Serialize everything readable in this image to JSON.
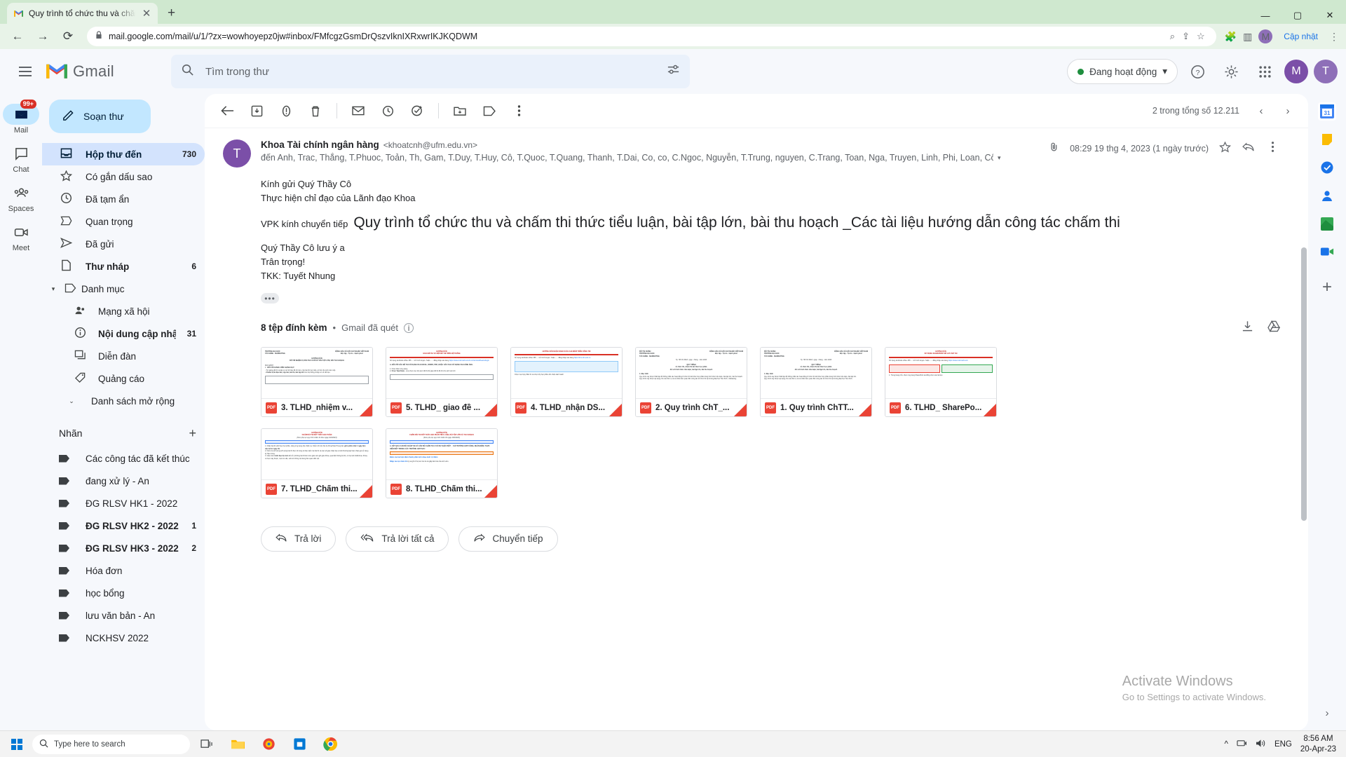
{
  "browser": {
    "tab": {
      "title": "Quy trình tổ chức thu và chăm th",
      "favicon": "gmail-icon",
      "close": "✕"
    },
    "newtab": "+",
    "window_controls": {
      "minimize": "—",
      "maximize": "▢",
      "close": "✕"
    },
    "nav": {
      "back": "←",
      "forward": "→",
      "reload": "⟳"
    },
    "url": "mail.google.com/mail/u/1/?zx=wowhoyepz0jw#inbox/FMfcgzGsmDrQszvIknIXRxwrIKJKQDWM",
    "lock_icon": "lock-icon",
    "omni_icons": [
      "zoom-icon",
      "share-icon",
      "bookmark-star-icon"
    ],
    "ext_icons": [
      "puzzle-extension-icon",
      "sidepanel-icon"
    ],
    "profile_initial": "M",
    "update_label": "Cập nhật",
    "menu": "⋮"
  },
  "gmail": {
    "logo_text": "Gmail",
    "search": {
      "placeholder": "Tìm trong thư",
      "value": "",
      "icon": "search-icon",
      "options_icon": "search-options-icon"
    },
    "status_chip": {
      "label": "Đang hoạt động",
      "dot_color": "#1e8e3e",
      "caret": "▾"
    },
    "header_icons": [
      "help-icon",
      "settings-gear-icon",
      "apps-grid-icon"
    ],
    "workspace_initial": "M",
    "account_initial": "T"
  },
  "rail": [
    {
      "label": "Mail",
      "icon": "mail-icon",
      "badge": "99+",
      "active": true
    },
    {
      "label": "Chat",
      "icon": "chat-icon",
      "badge": "",
      "active": false
    },
    {
      "label": "Spaces",
      "icon": "spaces-icon",
      "badge": "",
      "active": false
    },
    {
      "label": "Meet",
      "icon": "meet-camera-icon",
      "badge": "",
      "active": false
    }
  ],
  "sidebar": {
    "compose": {
      "label": "Soạn thư",
      "icon": "pencil-icon"
    },
    "nav": [
      {
        "label": "Hộp thư đến",
        "icon": "inbox-icon",
        "count": "730",
        "active": true,
        "bold": true
      },
      {
        "label": "Có gắn dấu sao",
        "icon": "star-icon",
        "count": "",
        "active": false,
        "bold": false
      },
      {
        "label": "Đã tạm ẩn",
        "icon": "clock-icon",
        "count": "",
        "active": false,
        "bold": false
      },
      {
        "label": "Quan trọng",
        "icon": "important-marker-icon",
        "count": "",
        "active": false,
        "bold": false
      },
      {
        "label": "Đã gửi",
        "icon": "send-icon",
        "count": "",
        "active": false,
        "bold": false
      },
      {
        "label": "Thư nháp",
        "icon": "draft-file-icon",
        "count": "6",
        "active": false,
        "bold": true
      }
    ],
    "categories": {
      "label": "Danh mục",
      "icon": "label-tag-icon",
      "caret": "▾"
    },
    "sub_items": [
      {
        "label": "Mạng xã hội",
        "icon": "social-people-icon",
        "count": "",
        "bold": false
      },
      {
        "label": "Nội dung cập nhật",
        "icon": "info-circle-icon",
        "count": "31",
        "bold": true
      },
      {
        "label": "Diễn đàn",
        "icon": "forums-icon",
        "count": "",
        "bold": false
      },
      {
        "label": "Quảng cáo",
        "icon": "promotions-tag-icon",
        "count": "",
        "bold": false
      }
    ],
    "expand": {
      "label": "Danh sách mở rộng",
      "caret": "⌄"
    },
    "labels_header": {
      "title": "Nhãn",
      "add_icon": "plus-icon"
    },
    "labels": [
      {
        "label": "Các công tác đã kết thúc",
        "count": "",
        "bold": false
      },
      {
        "label": "đang xử lý - An",
        "count": "",
        "bold": false
      },
      {
        "label": "ĐG RLSV HK1 - 2022",
        "count": "",
        "bold": false
      },
      {
        "label": "ĐG RLSV HK2 - 2022",
        "count": "1",
        "bold": true
      },
      {
        "label": "ĐG RLSV HK3 - 2022",
        "count": "2",
        "bold": true
      },
      {
        "label": "Hóa đơn",
        "count": "",
        "bold": false
      },
      {
        "label": "học bổng",
        "count": "",
        "bold": false
      },
      {
        "label": "lưu văn bản - An",
        "count": "",
        "bold": false
      },
      {
        "label": "NCKHSV 2022",
        "count": "",
        "bold": false
      }
    ]
  },
  "toolbar": {
    "back_icon": "back-arrow-icon",
    "icons": [
      "archive-icon",
      "report-spam-icon",
      "delete-trash-icon",
      "mark-unread-envelope-icon",
      "snooze-clock-icon",
      "add-to-tasks-icon",
      "move-to-folder-icon",
      "labels-tag-icon",
      "more-options-icon"
    ],
    "page_count": "2 trong tổng số 12.211",
    "prev": "‹",
    "next": "›"
  },
  "message": {
    "avatar_initial": "T",
    "sender_name": "Khoa Tài chính ngân hàng",
    "sender_email": "<khoatcnh@ufm.edu.vn>",
    "recipients": "đến Anh, Trac, Thắng, T.Phuoc, Toản, Th, Gam, T.Duy, T.Huy, Cô, T.Quoc, T.Quang, Thanh, T.Dai, Co, co, C.Ngoc, Nguyễn, T.Trung, nguyen, C.Trang, Toan, Nga, Truyen, Linh, Phi, Loan, Cô, Diện, Than, Phúc, Hoa, C.Lan",
    "recipients_caret": "▾",
    "attachment_clip_icon": "paperclip-icon",
    "timestamp": "08:29 19 thg 4, 2023 (1 ngày trước)",
    "star_icon": "star-outline-icon",
    "reply_icon": "reply-arrow-icon",
    "more_icon": "more-vertical-icon",
    "body": {
      "line1": "Kính gửi Quý Thầy Cô",
      "line2": "Thực hiện chỉ đạo của Lãnh đạo Khoa",
      "forward_prefix": "VPK kính chuyển tiếp",
      "headline": "Quy trình tổ chức thu và chấm thi thức tiểu luận, bài tập lớn, bài thu hoạch _Các tài liệu hướng dẫn công tác chấm thi",
      "line3": "Quý Thầy Cô lưu ý a",
      "line4": "Trân trọng!",
      "line5": "TKK: Tuyết Nhung",
      "expand_dots": "•••"
    }
  },
  "attachments": {
    "title": "8 tệp đính kèm",
    "separator": "•",
    "scanned": "Gmail đã quét",
    "info_icon": "info-circle-icon",
    "download_all_icon": "download-icon",
    "save_to_drive_icon": "save-to-drive-icon",
    "items": [
      {
        "name": "3. TLHD_nhiệm v...",
        "type": "PDF"
      },
      {
        "name": "5. TLHD_ giao đề ...",
        "type": "PDF"
      },
      {
        "name": "4. TLHD_nhận DS...",
        "type": "PDF"
      },
      {
        "name": "2. Quy trình ChT_...",
        "type": "PDF"
      },
      {
        "name": "1. Quy trình ChTT...",
        "type": "PDF"
      },
      {
        "name": "6. TLHD_ SharePo...",
        "type": "PDF"
      },
      {
        "name": "7. TLHD_Chấm thi...",
        "type": "PDF"
      },
      {
        "name": "8. TLHD_Chấm thi...",
        "type": "PDF"
      }
    ]
  },
  "reply_actions": [
    {
      "label": "Trả lời",
      "icon": "reply-arrow-icon"
    },
    {
      "label": "Trả lời tất cả",
      "icon": "reply-all-arrow-icon"
    },
    {
      "label": "Chuyển tiếp",
      "icon": "forward-arrow-icon"
    }
  ],
  "watermark": {
    "line1": "Activate Windows",
    "line2": "Go to Settings to activate Windows."
  },
  "right_rail": {
    "icons": [
      "calendar-31-icon",
      "keep-notes-icon",
      "tasks-icon",
      "contacts-icon",
      "maps-icon",
      "meet-video-icon"
    ],
    "add": "+",
    "expand": "›"
  },
  "taskbar": {
    "start_icon": "windows-start-icon",
    "search_placeholder": "Type here to search",
    "search_icon": "search-icon",
    "apps": [
      "task-view-icon",
      "file-explorer-icon",
      "paint-icon",
      "store-icon",
      "chrome-icon"
    ],
    "tray": {
      "chevron": "^",
      "network_icon": "network-icon",
      "sound_icon": "sound-icon",
      "language": "ENG"
    },
    "clock": {
      "time": "8:56 AM",
      "date": "20-Apr-23"
    }
  }
}
